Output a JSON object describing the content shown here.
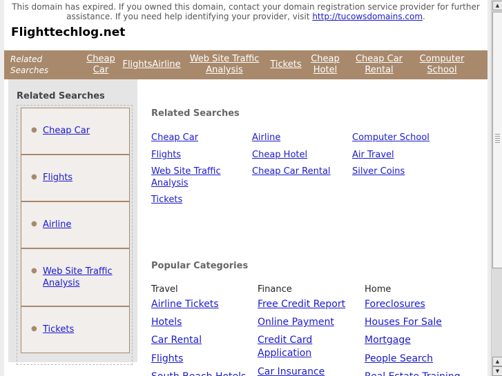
{
  "notice": {
    "text": "This domain has expired. If you owned this domain, contact your domain registration service provider for further assistance. If you need help identifying your provider, visit",
    "link": "http://tucowsdomains.com",
    "end": "."
  },
  "site_title": "Flighttechlog.net",
  "navbar": {
    "intro": "Related Searches",
    "links": [
      "Cheap Car",
      "Flights",
      "Airline",
      "Web Site Traffic Analysis",
      "Tickets",
      "Cheap Hotel",
      "Cheap Car Rental",
      "Computer School"
    ]
  },
  "sidebar": {
    "title": "Related Searches",
    "items": [
      "Cheap Car",
      "Flights",
      "Airline",
      "Web Site Traffic Analysis",
      "Tickets"
    ]
  },
  "related": {
    "heading": "Related Searches",
    "links": [
      "Cheap Car",
      "Flights",
      "Web Site Traffic Analysis",
      "Tickets",
      "Airline",
      "Cheap Hotel",
      "Cheap Car Rental",
      "Computer School",
      "Air Travel",
      "Silver Coins"
    ]
  },
  "popular": {
    "heading": "Popular Categories",
    "columns": [
      {
        "title": "Travel",
        "links": [
          "Airline Tickets",
          "Hotels",
          "Car Rental",
          "Flights",
          "South Beach Hotels"
        ]
      },
      {
        "title": "Finance",
        "links": [
          "Free Credit Report",
          "Online Payment",
          "Credit Card Application",
          "Car Insurance"
        ]
      },
      {
        "title": "Home",
        "links": [
          "Foreclosures",
          "Houses For Sale",
          "Mortgage",
          "People Search",
          "Real Estate Training"
        ]
      }
    ]
  },
  "colors": {
    "nav_bar": "#a8896c",
    "link": "#1a1acc",
    "sidebar_bg": "#e5e5e5"
  },
  "icons": {
    "scroll_up": "arrow-up-icon",
    "scroll_down": "arrow-down-icon"
  }
}
